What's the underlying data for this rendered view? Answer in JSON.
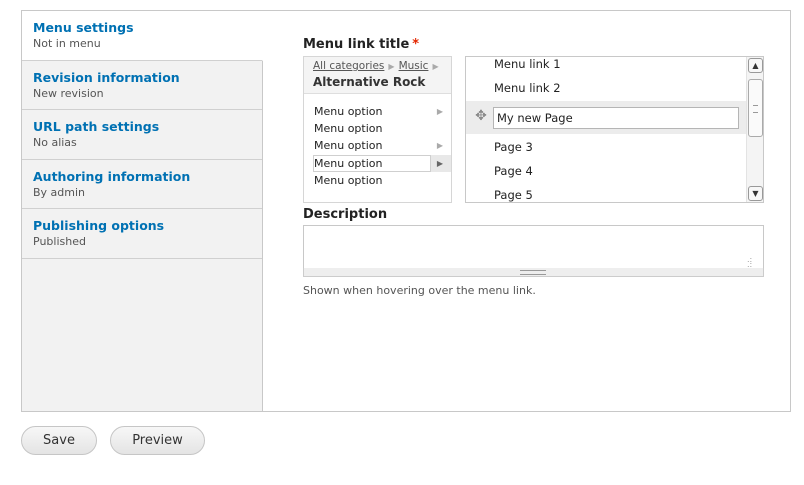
{
  "tabs": [
    {
      "title": "Menu settings",
      "summary": "Not in menu"
    },
    {
      "title": "Revision information",
      "summary": "New revision"
    },
    {
      "title": "URL path settings",
      "summary": "No alias"
    },
    {
      "title": "Authoring information",
      "summary": "By admin"
    },
    {
      "title": "Publishing options",
      "summary": "Published"
    }
  ],
  "menu_link": {
    "label": "Menu link title",
    "required_mark": "*",
    "breadcrumb": [
      "All categories",
      "Music"
    ],
    "current_category": "Alternative Rock",
    "options": [
      "Menu option",
      "Menu option",
      "Menu option",
      "Menu option",
      "Menu option"
    ],
    "list_items": [
      "Menu link 1",
      "Menu link 2",
      "Page 3",
      "Page 4",
      "Page 5"
    ],
    "editing_value": "My new Page"
  },
  "description": {
    "label": "Description",
    "value": "",
    "help": "Shown when hovering over the menu link."
  },
  "actions": {
    "save": "Save",
    "preview": "Preview"
  }
}
